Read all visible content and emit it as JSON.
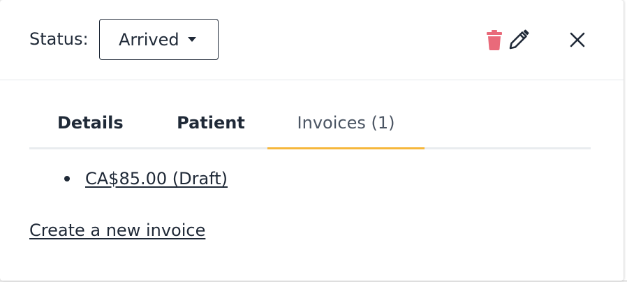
{
  "header": {
    "status_label": "Status:",
    "status_value": "Arrived",
    "icons": {
      "delete": "trash-icon",
      "edit": "pencil-icon",
      "close": "close-icon"
    },
    "colors": {
      "delete_icon": "#e96a7a",
      "text": "#1f2937"
    }
  },
  "tabs": [
    {
      "label": "Details",
      "active": false
    },
    {
      "label": "Patient",
      "active": false
    },
    {
      "label": "Invoices (1)",
      "active": true
    }
  ],
  "tab_accent": "#f6b73c",
  "invoices": {
    "items": [
      {
        "label": "CA$85.00 (Draft)"
      }
    ],
    "create_link": "Create a new invoice"
  }
}
